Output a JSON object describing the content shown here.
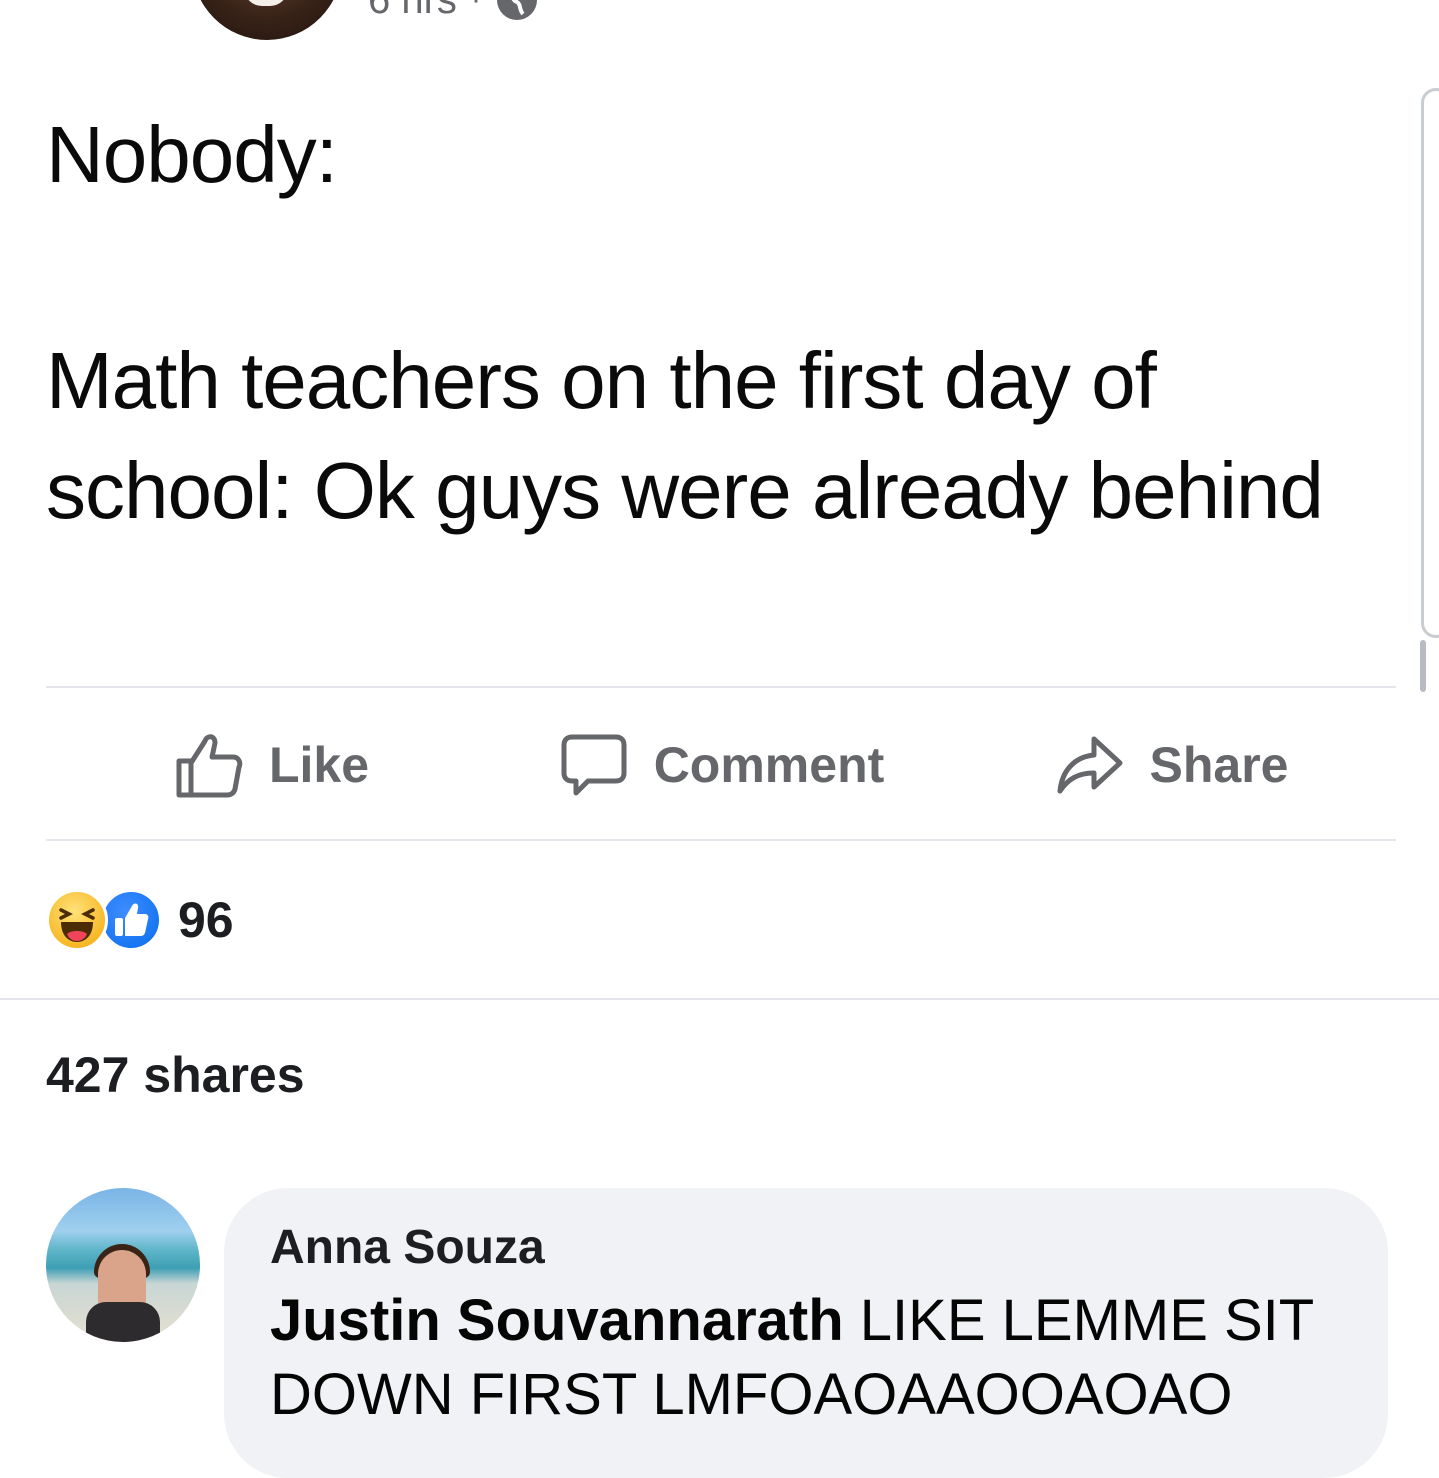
{
  "post": {
    "time": "6 hrs",
    "separator": "·",
    "privacy_icon": "globe-icon",
    "text_line1": "Nobody:",
    "text_line2": "Math teachers on the first day of school: Ok guys were already behind"
  },
  "actions": {
    "like_label": "Like",
    "comment_label": "Comment",
    "share_label": "Share"
  },
  "stats": {
    "reaction_icons": [
      "haha-icon",
      "like-icon"
    ],
    "reaction_count": "96",
    "shares": "427 shares"
  },
  "comment": {
    "author": "Anna Souza",
    "mention": "Justin Souvannarath",
    "text": " LIKE LEMME SIT DOWN FIRST LMFOAOAAOOAOAO"
  },
  "colors": {
    "divider": "#e4e6eb",
    "action_gray": "#65676b",
    "like_blue": "#1877f2",
    "haha_yellow": "#f7b928",
    "bubble_bg": "#f0f2f5"
  }
}
